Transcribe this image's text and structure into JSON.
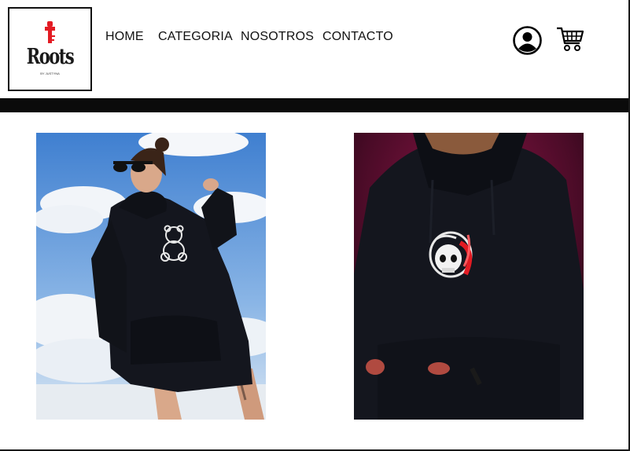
{
  "brand": {
    "name": "Roots",
    "tagline": "BY JUSTYNA"
  },
  "nav": {
    "items": [
      "HOME",
      "CATEGORIA",
      "NOSOTROS",
      "CONTACTO"
    ]
  },
  "header_icons": {
    "account": "user-circle-icon",
    "cart": "shopping-cart-icon"
  },
  "colors": {
    "band": "#0b0b0b",
    "logo_accent": "#e31b23",
    "sky": "#6fa4dc",
    "hoodie": "#14161e",
    "studio_bg": "#6e1038"
  },
  "products": [
    {
      "image": "woman in black hoodie with teddy bear print against sky"
    },
    {
      "image": "man in black hoodie with skull and snake print"
    }
  ]
}
